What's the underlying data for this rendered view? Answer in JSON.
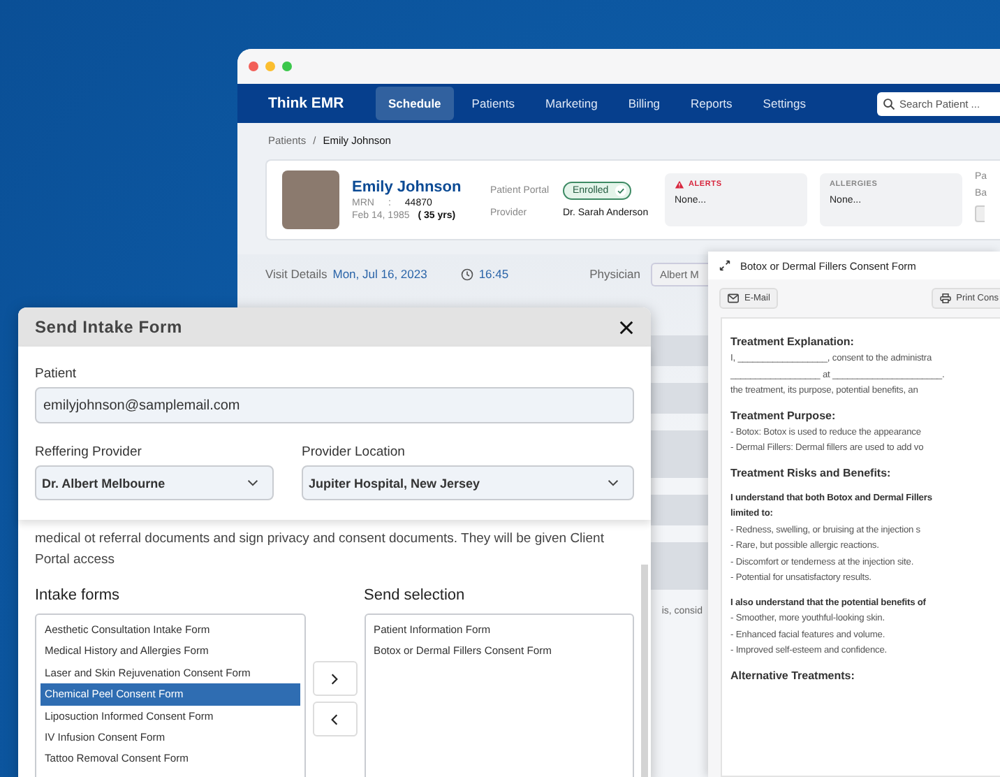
{
  "nav": {
    "logo": "Think EMR",
    "tabs": [
      {
        "label": "Schedule",
        "selected": true
      },
      {
        "label": "Patients",
        "selected": false
      },
      {
        "label": "Marketing",
        "selected": false
      },
      {
        "label": "Billing",
        "selected": false
      },
      {
        "label": "Reports",
        "selected": false
      },
      {
        "label": "Settings",
        "selected": false
      }
    ],
    "search": {
      "placeholder": "Search Patient ..."
    }
  },
  "breadcrumb": {
    "items": [
      "Patients",
      "Emily Johnson"
    ],
    "separator": "/"
  },
  "patient": {
    "name": "Emily Johnson",
    "mrn_label": "MRN",
    "mrn_separator": ":",
    "mrn": "44870",
    "dob": "Feb 14, 1985",
    "age": "( 35 yrs)",
    "portal_label": "Patient Portal",
    "portal_status": "Enrolled",
    "portal_enrolled": true,
    "provider_label": "Provider",
    "provider": "Dr. Sarah Anderson"
  },
  "info_cards": [
    {
      "kind": "alert",
      "title": "ALERTS",
      "value": "None..."
    },
    {
      "kind": "plain",
      "title": "ALLERGIES",
      "value": "None..."
    }
  ],
  "patient_card_column_3": {
    "line_1": "Pa",
    "line_2": "Ba"
  },
  "visit": {
    "label": "Visit Details",
    "date": "Mon, Jul 16, 2023",
    "time": "16:45",
    "physician_label": "Physician",
    "physician": "Albert M",
    "notes_fragment": "is, consid"
  },
  "consent_panel": {
    "title": "Botox or Dermal Fillers Consent Form",
    "buttons": [
      {
        "kind": "email",
        "label": "E-Mail"
      },
      {
        "kind": "print",
        "label": "Print Cons"
      }
    ],
    "sections": [
      {
        "title": "Treatment Explanation:",
        "lines": [
          {
            "text": "I, __________________, consent to the administra",
            "bold": false
          },
          {
            "text": "__________________ at ______________________.",
            "bold": false
          },
          {
            "text": "the treatment, its purpose, potential benefits, an",
            "bold": false
          }
        ]
      },
      {
        "title": "Treatment Purpose:",
        "lines": [
          {
            "text": "- Botox: Botox is used to reduce the appearance",
            "bold": false
          },
          {
            "text": "- Dermal Fillers: Dermal fillers are used to add vo",
            "bold": false
          }
        ]
      },
      {
        "title": "Treatment Risks and Benefits:"
      },
      {
        "lines": [
          {
            "text": "I understand that both Botox and Dermal Fillers",
            "bold": true
          },
          {
            "text": "limited to:",
            "bold": true
          },
          {
            "text": "- Redness, swelling, or bruising at the injection s",
            "bold": false
          },
          {
            "text": "- Rare, but possible allergic reactions.",
            "bold": false
          },
          {
            "text": "- Discomfort or tenderness at the injection site.",
            "bold": false
          },
          {
            "text": "- Potential for unsatisfactory results.",
            "bold": false
          }
        ]
      },
      {
        "lines": [
          {
            "text": "I also understand that the potential benefits of",
            "bold": true
          },
          {
            "text": "- Smoother, more youthful-looking skin.",
            "bold": false
          },
          {
            "text": "- Enhanced facial features and volume.",
            "bold": false
          },
          {
            "text": "- Improved self-esteem and confidence.",
            "bold": false
          }
        ]
      },
      {
        "title": "Alternative Treatments:"
      }
    ]
  },
  "modal": {
    "title": "Send Intake Form",
    "patient_label": "Patient",
    "patient_value": "emilyjohnson@samplemail.com",
    "referring_label": "Reffering Provider",
    "referring_value": "Dr. Albert Melbourne",
    "location_label": "Provider Location",
    "location_value": "Jupiter Hospital, New Jersey",
    "description": "medical ot referral documents and sign privacy and consent documents. They will be given Client Portal access",
    "intake_title": "Intake forms",
    "intake_forms": [
      {
        "label": "Aesthetic Consultation Intake Form",
        "selected": false
      },
      {
        "label": "Medical History and Allergies Form",
        "selected": false
      },
      {
        "label": "Laser and Skin Rejuvenation Consent Form",
        "selected": false
      },
      {
        "label": "Chemical Peel Consent Form",
        "selected": true
      },
      {
        "label": "Liposuction Informed Consent Form",
        "selected": false
      },
      {
        "label": "IV Infusion Consent Form",
        "selected": false
      },
      {
        "label": "Tattoo Removal Consent Form",
        "selected": false
      }
    ],
    "send_title": "Send selection",
    "send_selection": [
      "Patient Information Form",
      "Botox or Dermal Fillers Consent Form"
    ]
  }
}
